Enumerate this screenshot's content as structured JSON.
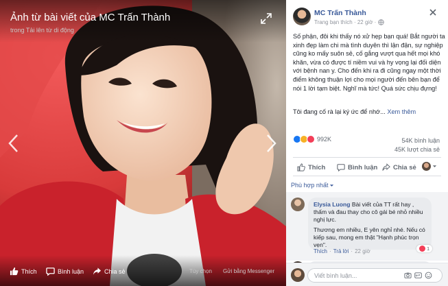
{
  "viewer": {
    "title": "Ảnh từ bài viết của MC Trấn Thành",
    "subtitle": "trong Tải lên từ di động",
    "actions": {
      "like": "Thích",
      "comment": "Bình luận",
      "share": "Chia sẻ"
    },
    "links": {
      "options": "Tùy chọn",
      "messenger": "Gửi bằng Messenger"
    }
  },
  "post": {
    "author": "MC Trấn Thành",
    "meta": "Trang bạn thích · 22 giờ ·",
    "text": "Số phận, đôi khi thấy nó xử hẹp bạn quá! Bắt người ta xinh đẹp làm chi mà tình duyên thì lận đận, sự nghiệp cũng ko mấy suôn sẻ, cố gắng vượt qua hết mọi khó khăn, vừa có được tí niềm vui và hy vọng lại đối diện với bệnh nan y. Cho đến khi ra đi cũng ngay một thời điểm không thuận lợi cho mọi người đến bên bạn để nói 1 lời tạm biệt. Nghĩ mà tức! Quá sức chịu đựng!",
    "text2": "Tôi đang cố rà lại ký ức để nhớ...",
    "see_more": "Xem thêm",
    "reaction_count": "992K",
    "comment_count": "54K bình luận",
    "share_count": "45K lượt chia sẻ",
    "actions": {
      "like": "Thích",
      "comment": "Bình luận",
      "share": "Chia sẻ"
    }
  },
  "comments": {
    "sort_label": "Phù hợp nhất",
    "items": [
      {
        "name": "Elysia Luong",
        "text": "Bài viết của TT rất hay , thấm và đau thay cho cô gái bé nhỏ nhiều nghị lực.",
        "text2": "Thương em nhiều, E yên nghỉ nhé. Nếu có kiếp sau, mong em thật \"Hạnh phúc trọn vẹn\".",
        "like": "Thích",
        "reply": "Trả lời",
        "time": "22 giờ",
        "reactions": "1"
      }
    ]
  },
  "composer": {
    "placeholder": "Viết bình luận..."
  },
  "colors": {
    "link": "#385898",
    "like_blue": "#1877f2",
    "love_red": "#f33e58",
    "sad_yellow": "#f7b125"
  },
  "icons": [
    "expand-icon",
    "prev-arrow-icon",
    "next-arrow-icon",
    "thumbs-up-icon",
    "comment-icon",
    "share-icon",
    "close-icon",
    "globe-icon",
    "camera-icon",
    "gif-icon",
    "sticker-icon",
    "caret-down-icon"
  ]
}
